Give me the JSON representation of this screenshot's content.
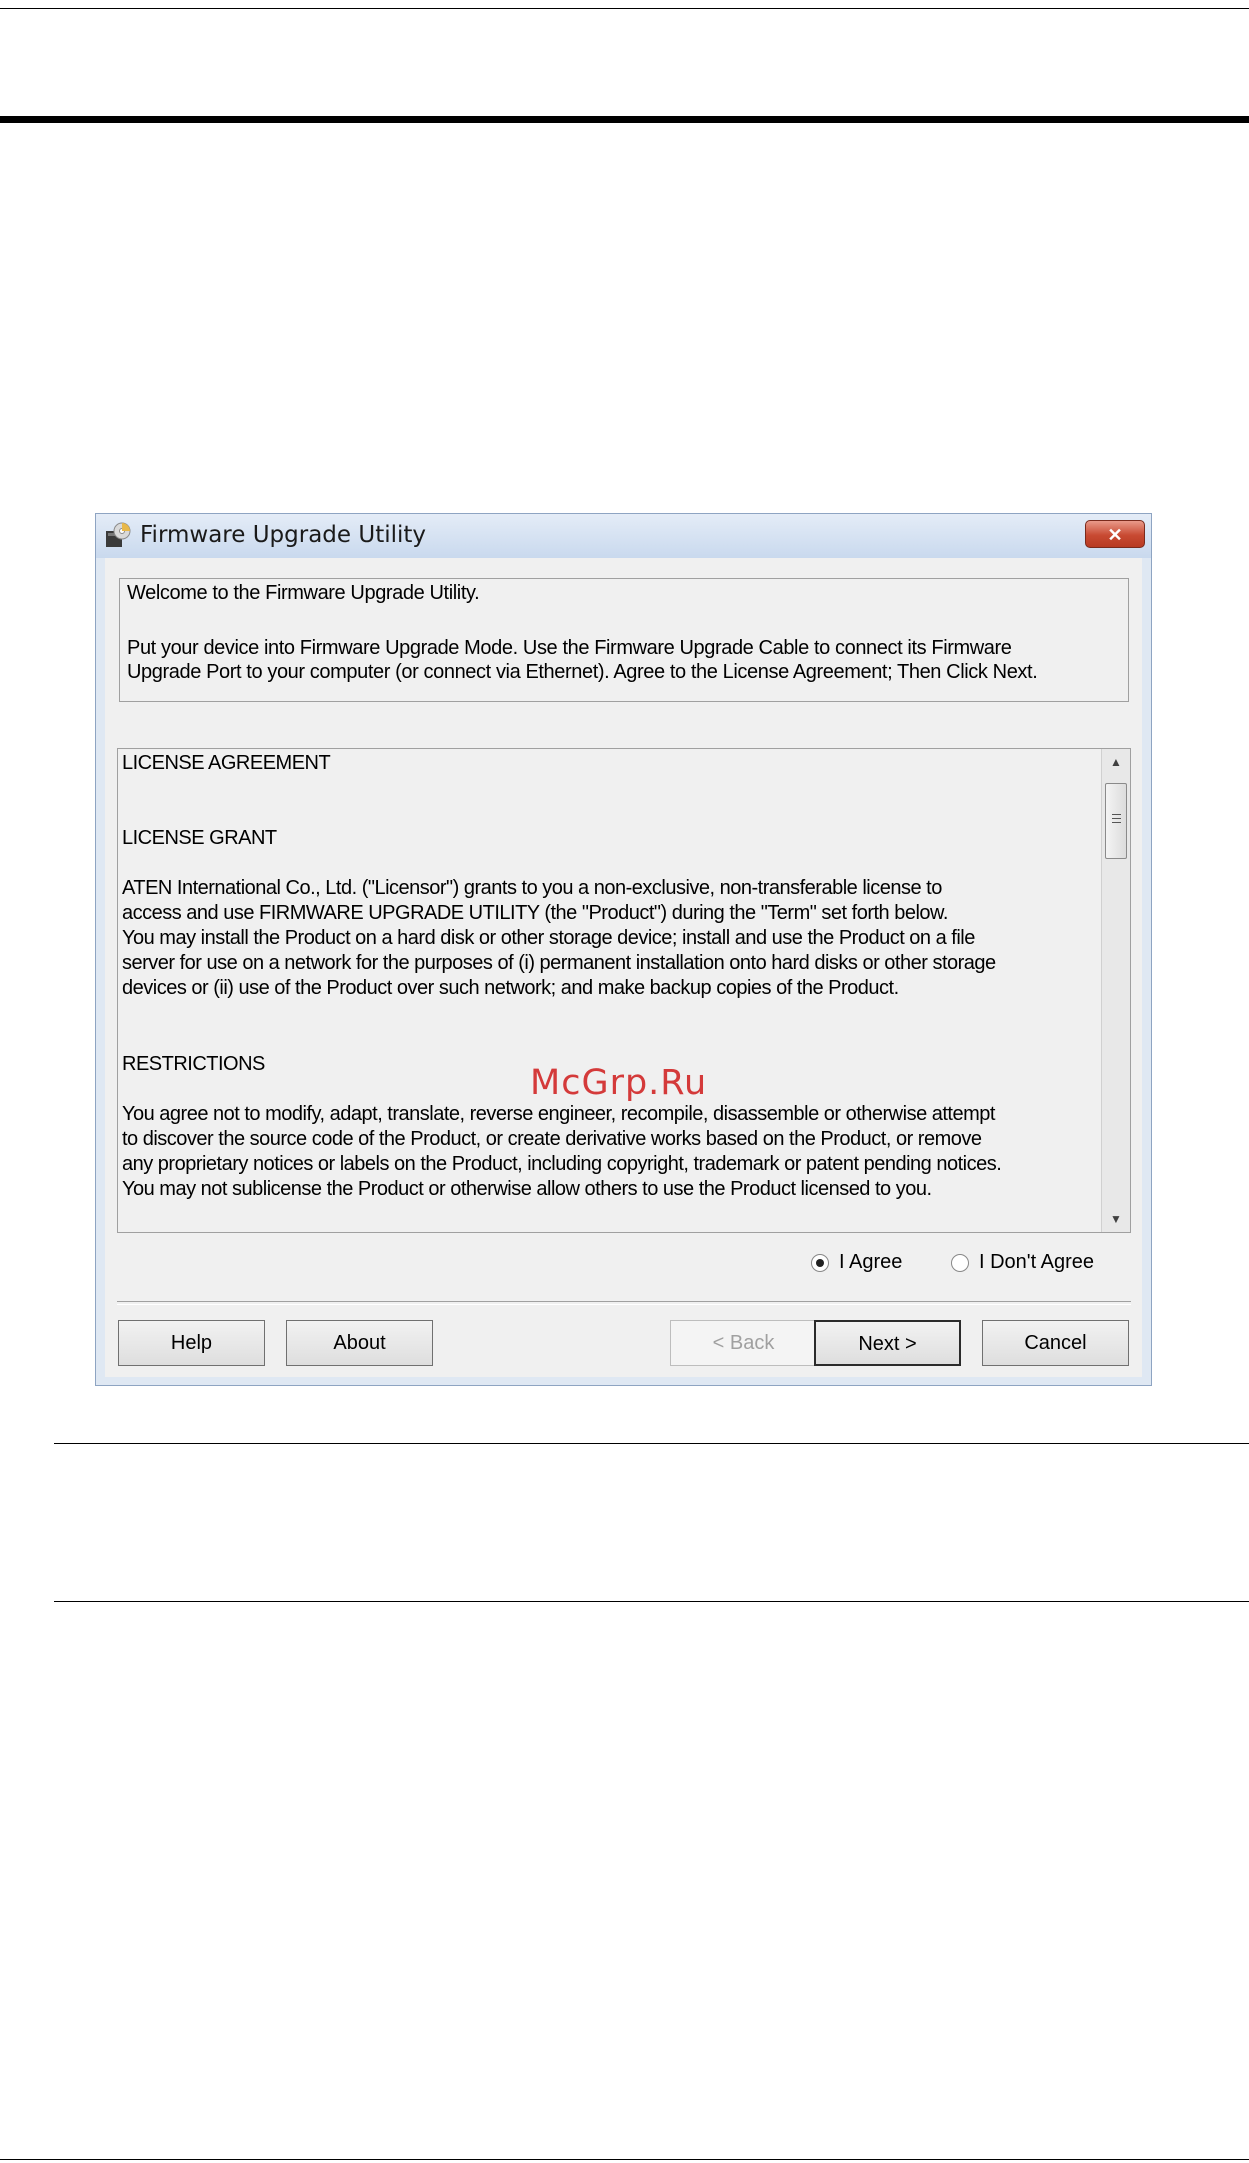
{
  "window": {
    "title": "Firmware Upgrade Utility",
    "close_label": "✕"
  },
  "intro": {
    "line1": "Welcome to the Firmware Upgrade Utility.",
    "line2": "Put your device into Firmware Upgrade Mode. Use the Firmware Upgrade Cable to connect its Firmware",
    "line3": "Upgrade Port to your computer (or connect via Ethernet). Agree to the License Agreement; Then Click Next."
  },
  "license": {
    "heading": "LICENSE AGREEMENT",
    "grant_heading": "LICENSE GRANT",
    "grant_text": "ATEN International Co., Ltd. (\"Licensor\") grants to you a non-exclusive, non-transferable license to\naccess and use FIRMWARE UPGRADE UTILITY (the \"Product\") during the \"Term\" set forth below.\nYou may install the Product on a hard disk or other storage device; install and use the Product on a file\nserver for use on a network for the purposes of (i) permanent installation onto hard disks or other storage\ndevices or (ii) use of the Product over such network; and make backup copies of the Product.",
    "restrictions_heading": "RESTRICTIONS",
    "restrictions_text": "You agree not to modify, adapt, translate, reverse engineer, recompile, disassemble or otherwise attempt\nto discover the source code of the Product, or create derivative works based on the Product, or remove\nany proprietary notices or labels on the Product, including copyright, trademark or patent pending notices.\nYou may not sublicense the Product or otherwise allow others to use the Product licensed to you."
  },
  "agreement": {
    "agree_label": "I Agree",
    "disagree_label": "I Don't Agree",
    "selected": "I Agree"
  },
  "buttons": {
    "help": "Help",
    "about": "About",
    "back": "< Back",
    "next": "Next >",
    "cancel": "Cancel"
  },
  "watermark": "McGrp.Ru",
  "icons": {
    "app": "firmware-disc-icon",
    "scroll_up": "scroll-up-arrow-icon",
    "scroll_down": "scroll-down-arrow-icon"
  }
}
